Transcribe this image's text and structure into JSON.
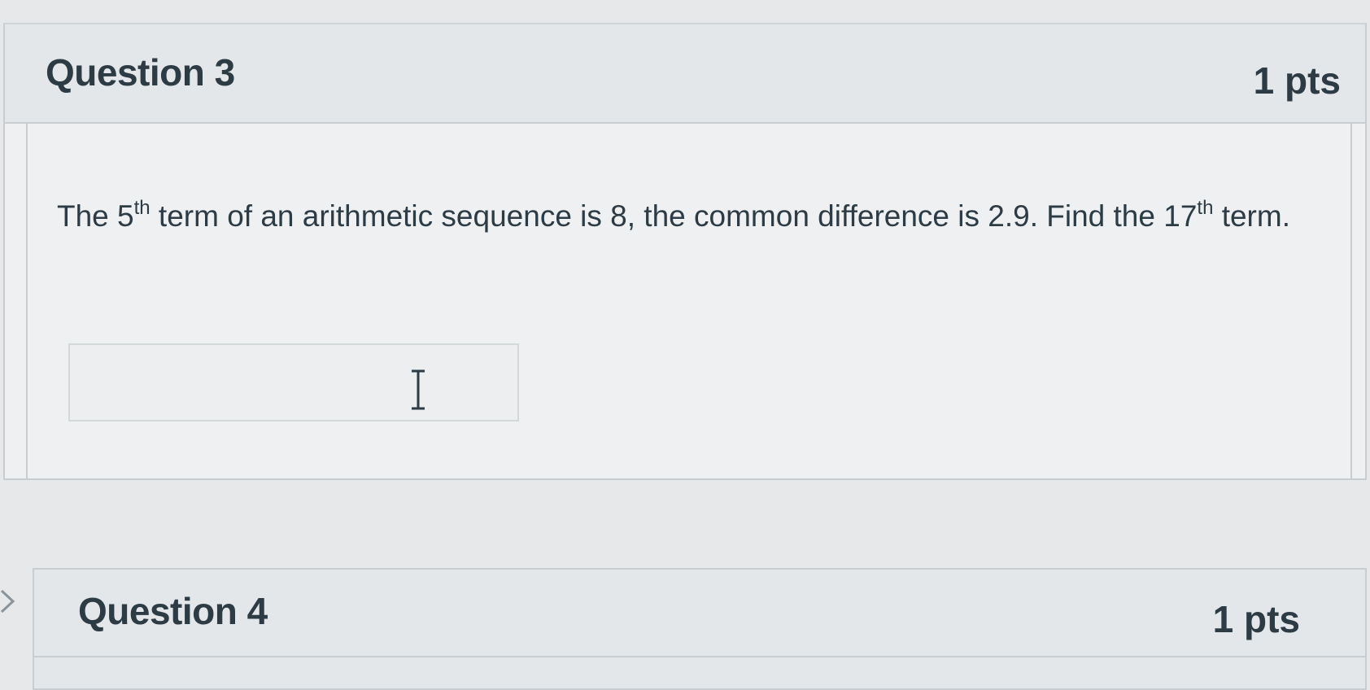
{
  "question3": {
    "title": "Question 3",
    "points": "1 pts",
    "text_part1": "The 5",
    "sup1": "th",
    "text_part2": " term of an arithmetic sequence is 8, the common difference is 2.9. Find the 17",
    "sup2": "th",
    "text_part3": " term.",
    "answer_value": "",
    "answer_placeholder": ""
  },
  "question4": {
    "title": "Question 4",
    "points": "1 pts"
  },
  "icons": {
    "cursor": "text-cursor-icon",
    "chevron": "chevron-right-icon"
  }
}
